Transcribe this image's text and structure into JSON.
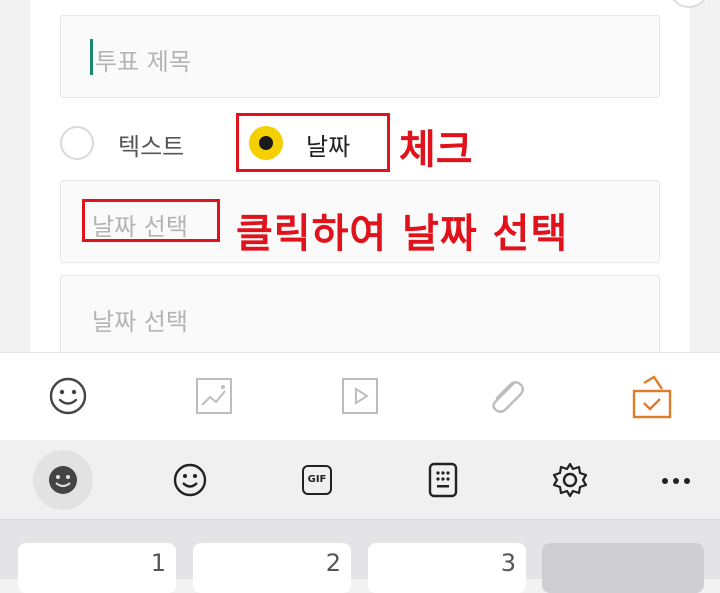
{
  "form": {
    "title_placeholder": "투표 제목",
    "type_options": [
      {
        "label": "텍스트",
        "selected": false
      },
      {
        "label": "날짜",
        "selected": true
      }
    ],
    "date_field_1_placeholder": "날짜 선택",
    "date_field_2_placeholder": "날짜 선택"
  },
  "annotations": {
    "check_label": "체크",
    "click_label": "클릭하여 날짜 선택",
    "color": "#e0121b"
  },
  "toolbar": {
    "icons": [
      "emoticon-icon",
      "image-icon",
      "video-icon",
      "attach-icon",
      "vote-icon"
    ],
    "active_color": "#e07b28"
  },
  "keyboard_bar": {
    "icons": [
      "emoji-face-icon",
      "smiley-icon",
      "gif-icon",
      "clipboard-keypad-icon",
      "settings-icon",
      "more-icon"
    ],
    "gif_label": "GIF"
  },
  "keyboard": {
    "keys": [
      "1",
      "2",
      "3"
    ]
  },
  "accent_color": "#f5d000"
}
